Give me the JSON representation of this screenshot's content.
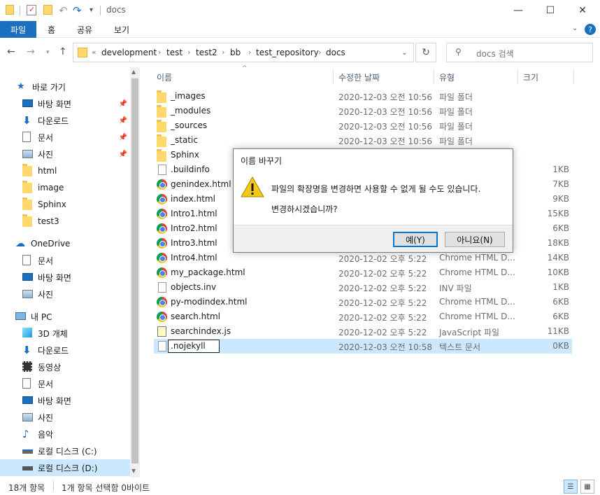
{
  "window": {
    "title": "docs",
    "controls": {
      "minimize": "—",
      "maximize": "☐",
      "close": "✕"
    }
  },
  "ribbon": {
    "tabs": [
      "파일",
      "홈",
      "공유",
      "보기"
    ],
    "help": "?"
  },
  "address": {
    "crumbs": [
      "development",
      "test",
      "test2",
      "bb",
      "test_repository",
      "docs"
    ],
    "overflow": "«",
    "search_placeholder": "docs 검색"
  },
  "nav": {
    "quick_access": "바로 가기",
    "pinned": [
      "바탕 화면",
      "다운로드",
      "문서",
      "사진"
    ],
    "folders": [
      "html",
      "image",
      "Sphinx",
      "test3"
    ],
    "onedrive": "OneDrive",
    "onedrive_items": [
      "문서",
      "바탕 화면",
      "사진"
    ],
    "this_pc": "내 PC",
    "pc_items": [
      "3D 개체",
      "다운로드",
      "동영상",
      "문서",
      "바탕 화면",
      "사진",
      "음악",
      "로컬 디스크 (C:)",
      "로컬 디스크 (D:)"
    ]
  },
  "columns": {
    "name": "이름",
    "date": "수정한 날짜",
    "type": "유형",
    "size": "크기"
  },
  "files": [
    {
      "name": "_images",
      "date": "2020-12-03 오전 10:56",
      "type": "파일 폴더",
      "size": "",
      "icon": "folder"
    },
    {
      "name": "_modules",
      "date": "2020-12-03 오전 10:56",
      "type": "파일 폴더",
      "size": "",
      "icon": "folder"
    },
    {
      "name": "_sources",
      "date": "2020-12-03 오전 10:56",
      "type": "파일 폴더",
      "size": "",
      "icon": "folder"
    },
    {
      "name": "_static",
      "date": "2020-12-03 오전 10:56",
      "type": "파일 폴더",
      "size": "",
      "icon": "folder"
    },
    {
      "name": "Sphinx",
      "date": "",
      "type": "",
      "size": "",
      "icon": "folder"
    },
    {
      "name": ".buildinfo",
      "date": "",
      "type": "",
      "size": "1KB",
      "icon": "file"
    },
    {
      "name": "genindex.html",
      "date": "",
      "type": "",
      "size": "7KB",
      "icon": "chrome"
    },
    {
      "name": "index.html",
      "date": "",
      "type": "",
      "size": "9KB",
      "icon": "chrome"
    },
    {
      "name": "Intro1.html",
      "date": "",
      "type": "",
      "size": "15KB",
      "icon": "chrome"
    },
    {
      "name": "Intro2.html",
      "date": "",
      "type": "",
      "size": "6KB",
      "icon": "chrome"
    },
    {
      "name": "Intro3.html",
      "date": "",
      "type": "",
      "size": "18KB",
      "icon": "chrome"
    },
    {
      "name": "Intro4.html",
      "date": "2020-12-02 오후 5:22",
      "type": "Chrome HTML D...",
      "size": "14KB",
      "icon": "chrome"
    },
    {
      "name": "my_package.html",
      "date": "2020-12-02 오후 5:22",
      "type": "Chrome HTML D...",
      "size": "10KB",
      "icon": "chrome"
    },
    {
      "name": "objects.inv",
      "date": "2020-12-02 오후 5:22",
      "type": "INV 파일",
      "size": "1KB",
      "icon": "file"
    },
    {
      "name": "py-modindex.html",
      "date": "2020-12-02 오후 5:22",
      "type": "Chrome HTML D...",
      "size": "6KB",
      "icon": "chrome"
    },
    {
      "name": "search.html",
      "date": "2020-12-02 오후 5:22",
      "type": "Chrome HTML D...",
      "size": "6KB",
      "icon": "chrome"
    },
    {
      "name": "searchindex.js",
      "date": "2020-12-02 오후 5:22",
      "type": "JavaScript 파일",
      "size": "11KB",
      "icon": "js"
    },
    {
      "name": ".nojekyll",
      "date": "2020-12-03 오전 10:58",
      "type": "텍스트 문서",
      "size": "0KB",
      "icon": "file"
    }
  ],
  "dialog": {
    "title": "이름 바꾸기",
    "message": "파일의 확장명을 변경하면 사용할 수 없게 될 수도 있습니다.",
    "question": "변경하시겠습니까?",
    "yes": "예(Y)",
    "no": "아니요(N)"
  },
  "status": {
    "count": "18개 항목",
    "selection": "1개 항목 선택함 0바이트"
  }
}
